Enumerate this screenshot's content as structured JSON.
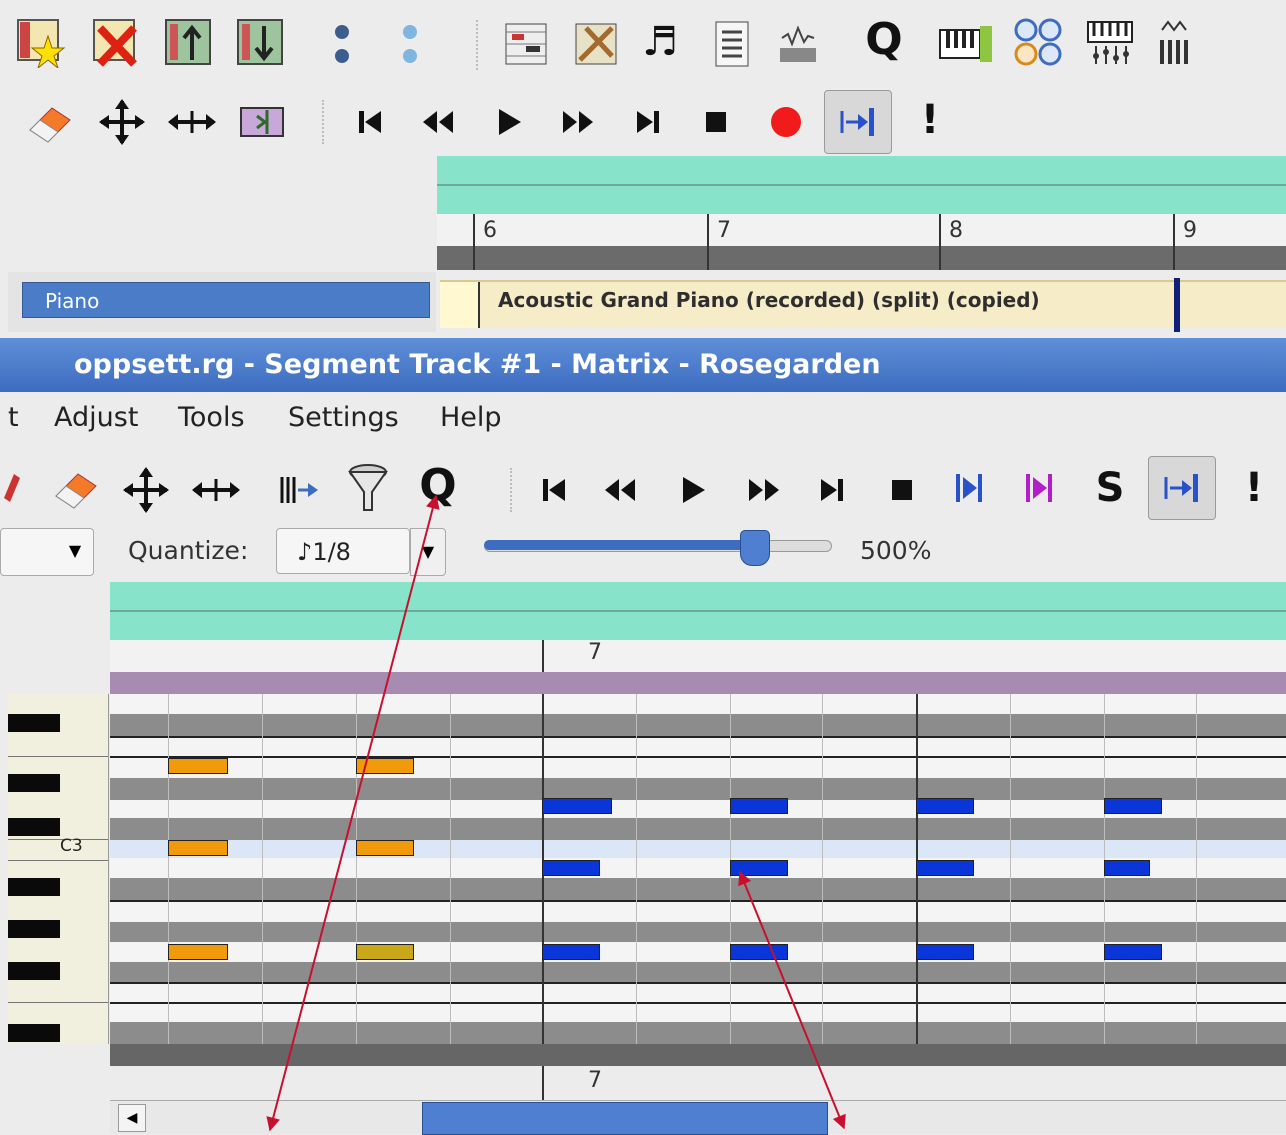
{
  "main_window": {
    "toolbar1_icons": [
      "add-star-icon",
      "delete-icon",
      "move-up-icon",
      "move-down-icon",
      "dots-icon",
      "dots-light-icon",
      "matrix-editor-icon",
      "percussion-editor-icon",
      "notation-editor-icon",
      "event-list-icon",
      "audio-icon",
      "quantize-icon",
      "midi-keyboard-icon",
      "mixer-icon",
      "audio-mixer-icon",
      "sliders-icon"
    ],
    "toolbar1_quantize_glyph": "Q",
    "toolbar2_exclaim": "!",
    "ruler_bars": [
      "6",
      "7",
      "8",
      "9"
    ],
    "track_name": "Piano",
    "segment_label": "Acoustic Grand Piano (recorded) (split) (copied)"
  },
  "matrix_window": {
    "title": "oppsett.rg - Segment Track #1 - Matrix - Rosegarden",
    "menu": {
      "partial": "t",
      "adjust": "Adjust",
      "tools": "Tools",
      "settings": "Settings",
      "help": "Help"
    },
    "toolbar": {
      "quantize_glyph": "Q",
      "solo_glyph": "S",
      "exclaim": "!"
    },
    "quantize_label": "Quantize:",
    "quantize_value": "♪1/8",
    "zoom": "500%",
    "zoom_level_fraction": 0.79,
    "bar_number": "7",
    "bottom_bar_number": "7",
    "pitch_label": "C3"
  },
  "colors": {
    "teal": "#87e3c9",
    "titlebar": "#3d6cc0",
    "note_orange": "#f09a0c",
    "note_blue": "#0a35d8",
    "arrow_red": "#c8102e"
  }
}
